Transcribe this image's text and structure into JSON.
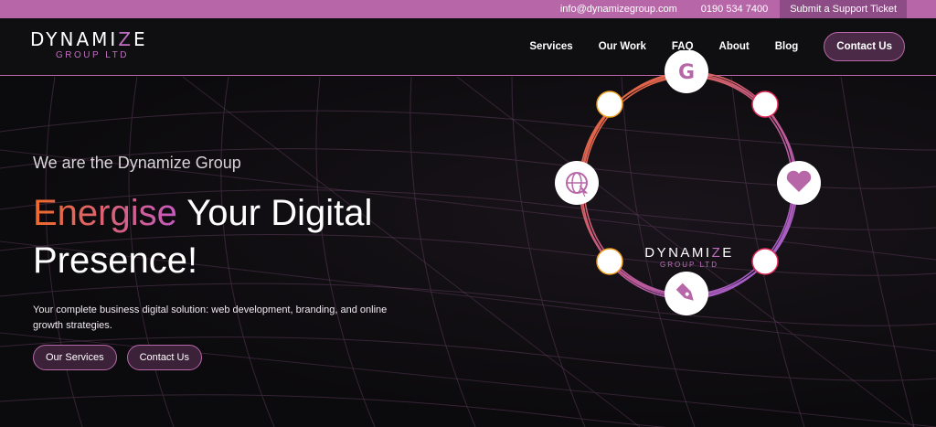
{
  "topbar": {
    "email": "info@dynamizegroup.com",
    "phone": "0190 534 7400",
    "ticket": "Submit a Support Ticket"
  },
  "logo": {
    "main_a": "DYNAMI",
    "main_z": "Z",
    "main_b": "E",
    "sub": "GROUP LTD"
  },
  "nav": {
    "items": [
      "Services",
      "Our Work",
      "FAQ",
      "About",
      "Blog"
    ],
    "cta": "Contact Us"
  },
  "hero": {
    "tagline": "We are the Dynamize Group",
    "headline_accent": "Energise",
    "headline_rest_1": " Your Digital",
    "headline_rest_2": "Presence!",
    "description": "Your complete business digital solution: web development, branding, and online growth strategies.",
    "buttons": [
      "Our Services",
      "Contact Us"
    ]
  },
  "ring": {
    "logo_a": "DYNAMI",
    "logo_z": "Z",
    "logo_b": "E",
    "logo_sub": "GROUP LTD",
    "icons": [
      "google-icon",
      "heart-icon",
      "pen-nib-icon",
      "globe-icon"
    ]
  },
  "colors": {
    "brand_pink": "#b767a8",
    "accent_orange": "#f06a2a",
    "accent_purple": "#9b5fe0",
    "background": "#0b0a0c"
  }
}
